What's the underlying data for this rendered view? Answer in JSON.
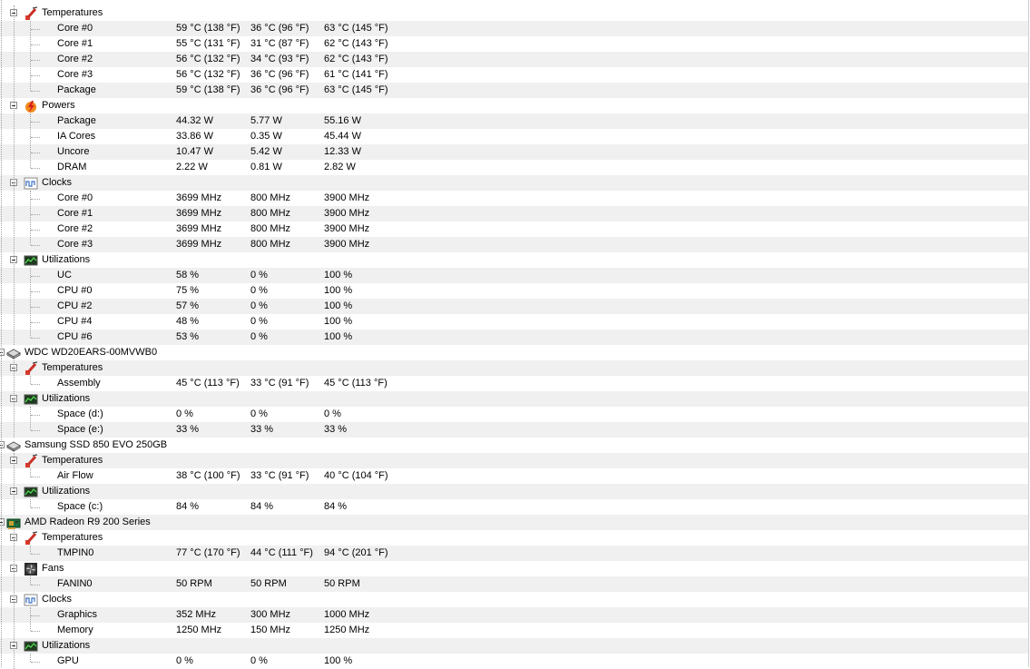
{
  "rows": [
    {
      "level": 1,
      "kind": "group",
      "icon": "temperature-icon",
      "label": "Temperatures"
    },
    {
      "level": 2,
      "kind": "sensor",
      "label": "Core #0",
      "value": "59 °C  (138 °F)",
      "min": "36 °C  (96 °F)",
      "max": "63 °C  (145 °F)"
    },
    {
      "level": 2,
      "kind": "sensor",
      "label": "Core #1",
      "value": "55 °C  (131 °F)",
      "min": "31 °C  (87 °F)",
      "max": "62 °C  (143 °F)"
    },
    {
      "level": 2,
      "kind": "sensor",
      "label": "Core #2",
      "value": "56 °C  (132 °F)",
      "min": "34 °C  (93 °F)",
      "max": "62 °C  (143 °F)"
    },
    {
      "level": 2,
      "kind": "sensor",
      "label": "Core #3",
      "value": "56 °C  (132 °F)",
      "min": "36 °C  (96 °F)",
      "max": "61 °C  (141 °F)"
    },
    {
      "level": 2,
      "kind": "sensor",
      "label": "Package",
      "value": "59 °C  (138 °F)",
      "min": "36 °C  (96 °F)",
      "max": "63 °C  (145 °F)"
    },
    {
      "level": 1,
      "kind": "group",
      "icon": "power-icon",
      "label": "Powers"
    },
    {
      "level": 2,
      "kind": "sensor",
      "label": "Package",
      "value": "44.32 W",
      "min": "5.77 W",
      "max": "55.16 W"
    },
    {
      "level": 2,
      "kind": "sensor",
      "label": "IA Cores",
      "value": "33.86 W",
      "min": "0.35 W",
      "max": "45.44 W"
    },
    {
      "level": 2,
      "kind": "sensor",
      "label": "Uncore",
      "value": "10.47 W",
      "min": "5.42 W",
      "max": "12.33 W"
    },
    {
      "level": 2,
      "kind": "sensor",
      "label": "DRAM",
      "value": "2.22 W",
      "min": "0.81 W",
      "max": "2.82 W"
    },
    {
      "level": 1,
      "kind": "group",
      "icon": "clock-icon",
      "label": "Clocks"
    },
    {
      "level": 2,
      "kind": "sensor",
      "label": "Core #0",
      "value": "3699 MHz",
      "min": "800 MHz",
      "max": "3900 MHz"
    },
    {
      "level": 2,
      "kind": "sensor",
      "label": "Core #1",
      "value": "3699 MHz",
      "min": "800 MHz",
      "max": "3900 MHz"
    },
    {
      "level": 2,
      "kind": "sensor",
      "label": "Core #2",
      "value": "3699 MHz",
      "min": "800 MHz",
      "max": "3900 MHz"
    },
    {
      "level": 2,
      "kind": "sensor",
      "label": "Core #3",
      "value": "3699 MHz",
      "min": "800 MHz",
      "max": "3900 MHz"
    },
    {
      "level": 1,
      "kind": "group",
      "icon": "utilization-icon",
      "label": "Utilizations"
    },
    {
      "level": 2,
      "kind": "sensor",
      "label": "UC",
      "value": "58 %",
      "min": "0 %",
      "max": "100 %"
    },
    {
      "level": 2,
      "kind": "sensor",
      "label": "CPU #0",
      "value": "75 %",
      "min": "0 %",
      "max": "100 %"
    },
    {
      "level": 2,
      "kind": "sensor",
      "label": "CPU #2",
      "value": "57 %",
      "min": "0 %",
      "max": "100 %"
    },
    {
      "level": 2,
      "kind": "sensor",
      "label": "CPU #4",
      "value": "48 %",
      "min": "0 %",
      "max": "100 %"
    },
    {
      "level": 2,
      "kind": "sensor",
      "label": "CPU #6",
      "value": "53 %",
      "min": "0 %",
      "max": "100 %"
    },
    {
      "level": 0,
      "kind": "device",
      "icon": "hard-drive-icon",
      "label": "WDC WD20EARS-00MVWB0"
    },
    {
      "level": 1,
      "kind": "group",
      "icon": "temperature-icon",
      "label": "Temperatures"
    },
    {
      "level": 2,
      "kind": "sensor",
      "label": "Assembly",
      "value": "45 °C  (113 °F)",
      "min": "33 °C  (91 °F)",
      "max": "45 °C  (113 °F)"
    },
    {
      "level": 1,
      "kind": "group",
      "icon": "utilization-icon",
      "label": "Utilizations"
    },
    {
      "level": 2,
      "kind": "sensor",
      "label": "Space (d:)",
      "value": "0 %",
      "min": "0 %",
      "max": "0 %"
    },
    {
      "level": 2,
      "kind": "sensor",
      "label": "Space (e:)",
      "value": "33 %",
      "min": "33 %",
      "max": "33 %"
    },
    {
      "level": 0,
      "kind": "device",
      "icon": "hard-drive-icon",
      "label": "Samsung SSD 850 EVO 250GB"
    },
    {
      "level": 1,
      "kind": "group",
      "icon": "temperature-icon",
      "label": "Temperatures"
    },
    {
      "level": 2,
      "kind": "sensor",
      "label": "Air Flow",
      "value": "38 °C  (100 °F)",
      "min": "33 °C  (91 °F)",
      "max": "40 °C  (104 °F)"
    },
    {
      "level": 1,
      "kind": "group",
      "icon": "utilization-icon",
      "label": "Utilizations"
    },
    {
      "level": 2,
      "kind": "sensor",
      "label": "Space (c:)",
      "value": "84 %",
      "min": "84 %",
      "max": "84 %"
    },
    {
      "level": 0,
      "kind": "device",
      "icon": "graphics-card-icon",
      "label": "AMD Radeon R9 200 Series"
    },
    {
      "level": 1,
      "kind": "group",
      "icon": "temperature-icon",
      "label": "Temperatures"
    },
    {
      "level": 2,
      "kind": "sensor",
      "label": "TMPIN0",
      "value": "77 °C  (170 °F)",
      "min": "44 °C  (111 °F)",
      "max": "94 °C  (201 °F)"
    },
    {
      "level": 1,
      "kind": "group",
      "icon": "fan-icon",
      "label": "Fans"
    },
    {
      "level": 2,
      "kind": "sensor",
      "label": "FANIN0",
      "value": "50 RPM",
      "min": "50 RPM",
      "max": "50 RPM"
    },
    {
      "level": 1,
      "kind": "group",
      "icon": "clock-icon",
      "label": "Clocks"
    },
    {
      "level": 2,
      "kind": "sensor",
      "label": "Graphics",
      "value": "352 MHz",
      "min": "300 MHz",
      "max": "1000 MHz"
    },
    {
      "level": 2,
      "kind": "sensor",
      "label": "Memory",
      "value": "1250 MHz",
      "min": "150 MHz",
      "max": "1250 MHz"
    },
    {
      "level": 1,
      "kind": "group",
      "icon": "utilization-icon",
      "label": "Utilizations"
    },
    {
      "level": 2,
      "kind": "sensor",
      "label": "GPU",
      "value": "0 %",
      "min": "0 %",
      "max": "100 %"
    }
  ]
}
